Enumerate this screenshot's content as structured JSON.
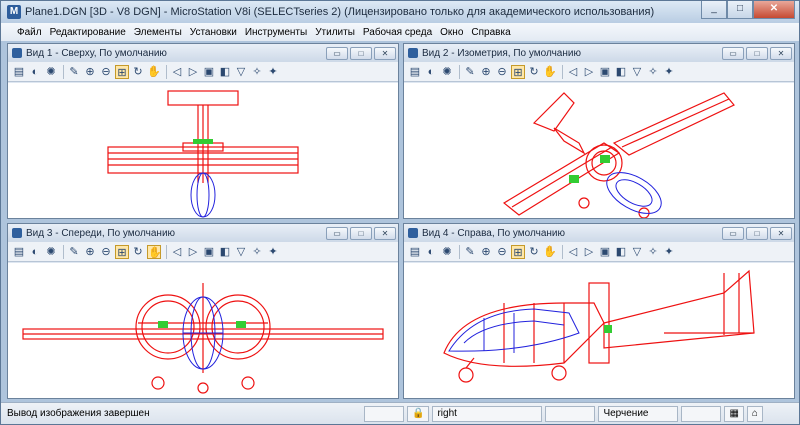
{
  "window": {
    "title": "Plane1.DGN [3D - V8 DGN] - MicroStation V8i (SELECTseries 2) (Лицензировано только для академического использования)"
  },
  "menu": [
    "Файл",
    "Редактирование",
    "Элементы",
    "Установки",
    "Инструменты",
    "Утилиты",
    "Рабочая среда",
    "Окно",
    "Справка"
  ],
  "views": [
    {
      "title": "Вид 1 - Сверху, По умолчанию"
    },
    {
      "title": "Вид 2 - Изометрия, По умолчанию"
    },
    {
      "title": "Вид 3 - Спереди, По умолчанию"
    },
    {
      "title": "Вид 4 - Справа, По умолчанию"
    }
  ],
  "view_buttons": {
    "restore": "▭",
    "maximize": "□",
    "close": "✕"
  },
  "status": {
    "message": "Вывод изображения завершен",
    "snap": "right",
    "mode": "Черчение"
  },
  "colors": {
    "wire": "#ee1111",
    "body": "#2222dd",
    "accent": "#33cc33"
  },
  "view_toolbar_icons": [
    "view-attributes-icon",
    "display-style-icon",
    "lighting-icon",
    "update-view-icon",
    "zoom-in-icon",
    "zoom-out-icon",
    "fit-view-icon",
    "rotate-view-icon",
    "pan-view-icon",
    "view-previous-icon",
    "view-next-icon",
    "clip-volume-icon",
    "camera-icon"
  ]
}
